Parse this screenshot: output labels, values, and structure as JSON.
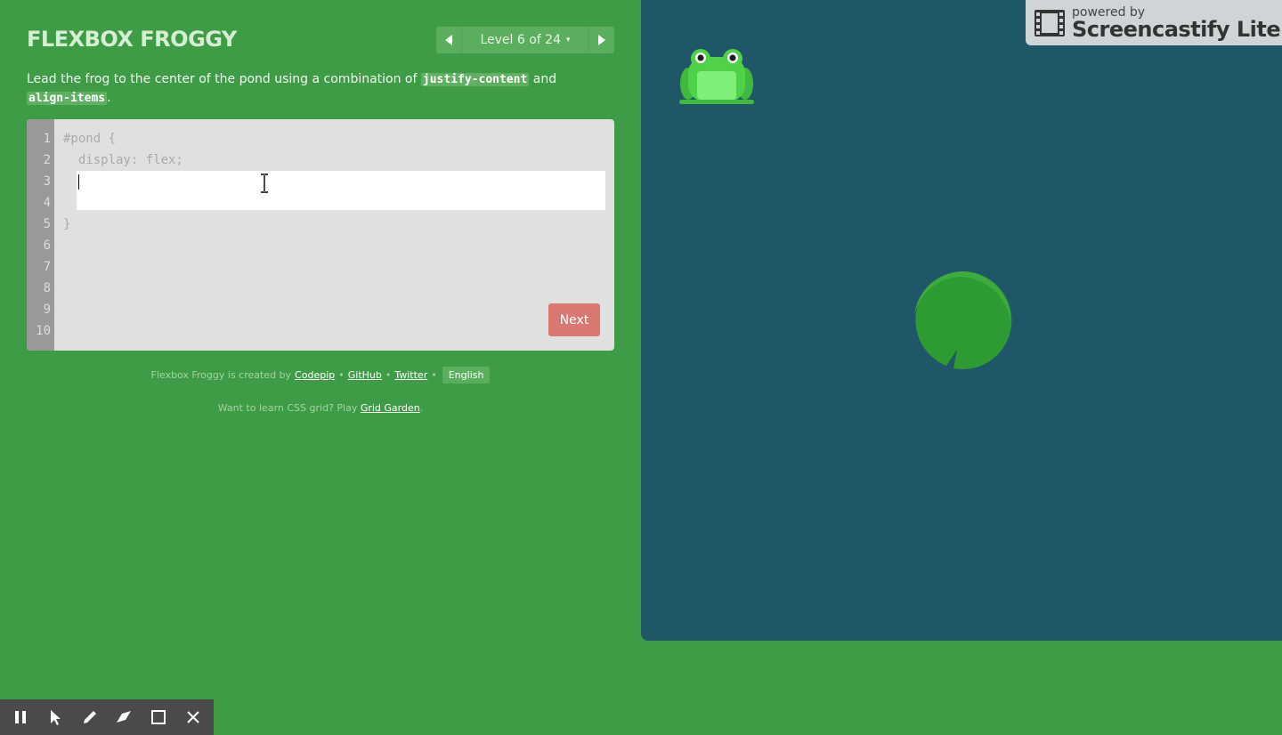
{
  "header": {
    "title": "FLEXBOX FROGGY",
    "level_label": "Level 6 of 24",
    "caret": "▾"
  },
  "instructions": {
    "before": "Lead the frog to the center of the pond using a combination of ",
    "code1": "justify-content",
    "middle": " and ",
    "code2": "align-items",
    "after": "."
  },
  "editor": {
    "line_numbers": [
      "1",
      "2",
      "3",
      "4",
      "5",
      "6",
      "7",
      "8",
      "9",
      "10"
    ],
    "line1": "#pond {",
    "line2": "  display: flex;",
    "line5": "}",
    "input_value": "",
    "next_label": "Next"
  },
  "footer": {
    "created_by": "Flexbox Froggy is created by",
    "codepip": "Codepip",
    "github": "GitHub",
    "twitter": "Twitter",
    "separator": "•",
    "language": "English",
    "grid_prefix": "Want to learn CSS grid? Play",
    "grid_link": "Grid Garden",
    "grid_suffix": "."
  },
  "watermark": {
    "small": "powered by",
    "big": "Screencastify Lite"
  },
  "toolbar": {
    "tools": [
      "pause-icon",
      "cursor-icon",
      "pen-icon",
      "highlighter-icon",
      "rectangle-icon",
      "close-icon"
    ]
  },
  "colors": {
    "background": "#3e9c47",
    "pond": "#1f5768",
    "frog": "#4fd14a",
    "lilypad": "#2e9a32",
    "next_button": "#d87870"
  }
}
